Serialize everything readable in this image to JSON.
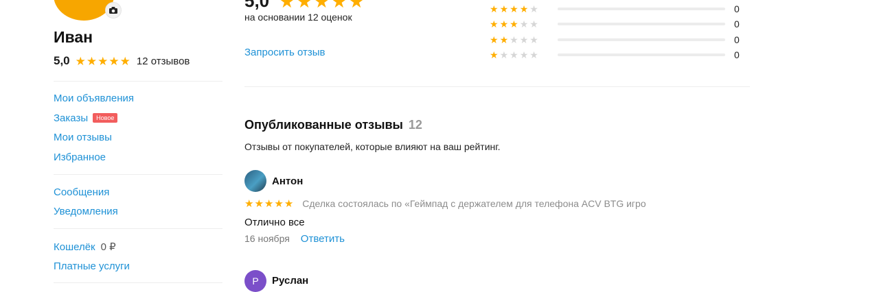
{
  "colors": {
    "accent": "#1e91d6",
    "star": "#ffae00",
    "badge": "#f25d5d",
    "avatar": "#f7a600"
  },
  "profile": {
    "name": "Иван",
    "rating": "5,0",
    "reviews_count": "12 отзывов",
    "camera_icon": "camera-icon"
  },
  "sidebar": {
    "group1": [
      {
        "label": "Мои объявления"
      },
      {
        "label": "Заказы",
        "badge": "Новое"
      },
      {
        "label": "Мои отзывы"
      },
      {
        "label": "Избранное"
      }
    ],
    "group2": [
      {
        "label": "Сообщения"
      },
      {
        "label": "Уведомления"
      }
    ],
    "wallet": {
      "label": "Кошелёк",
      "amount": "0 ₽"
    },
    "paid": {
      "label": "Платные услуги"
    }
  },
  "summary": {
    "rating": "5,0",
    "based_on": "на основании 12 оценок",
    "request_link": "Запросить отзыв",
    "distribution": [
      {
        "stars": 4,
        "count": "0",
        "fraction": 0
      },
      {
        "stars": 3,
        "count": "0",
        "fraction": 0
      },
      {
        "stars": 2,
        "count": "0",
        "fraction": 0
      },
      {
        "stars": 1,
        "count": "0",
        "fraction": 0
      }
    ]
  },
  "reviews_section": {
    "title": "Опубликованные отзывы",
    "count": "12",
    "subtitle": "Отзывы от покупателей, которые влияют на ваш рейтинг."
  },
  "reviews": [
    {
      "name": "Антон",
      "avatar_color": "#3a6f8f",
      "stars": 5,
      "deal": "Сделка состоялась по «Геймпад с держателем для телефона ACV BTG игро",
      "text": "Отлично все",
      "date": "16 ноября",
      "reply": "Ответить"
    },
    {
      "name": "Руслан",
      "avatar_color": "#7b4fc9",
      "avatar_letter": "Р"
    }
  ]
}
